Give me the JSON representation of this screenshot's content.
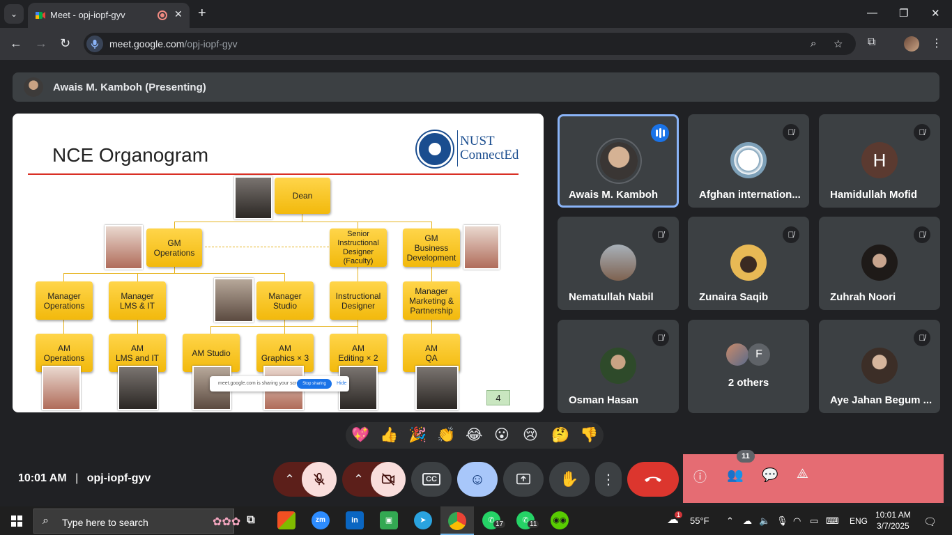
{
  "browser": {
    "tab_title": "Meet - opj-iopf-gyv",
    "url_host": "meet.google.com",
    "url_path": "/opj-iopf-gyv"
  },
  "meet": {
    "presenter_label": "Awais M. Kamboh (Presenting)",
    "meeting_code": "opj-iopf-gyv",
    "time": "10:01 AM",
    "time_separator": "|",
    "participants_count": "11"
  },
  "slide": {
    "title": "NCE Organogram",
    "logo_line1": "NUST",
    "logo_line2": "ConnectEd",
    "boxes": {
      "dean": "Dean",
      "gm_ops_1": "GM",
      "gm_ops_2": "Operations",
      "sid_1": "Senior",
      "sid_2": "Instructional",
      "sid_3": "Designer",
      "sid_4": "(Faculty)",
      "gm_bd_1": "GM",
      "gm_bd_2": "Business",
      "gm_bd_3": "Development",
      "mgr_ops_1": "Manager",
      "mgr_ops_2": "Operations",
      "mgr_lms_1": "Manager",
      "mgr_lms_2": "LMS & IT",
      "mgr_studio_1": "Manager",
      "mgr_studio_2": "Studio",
      "id_1": "Instructional",
      "id_2": "Designer",
      "mgr_mkt_1": "Manager",
      "mgr_mkt_2": "Marketing &",
      "mgr_mkt_3": "Partnership",
      "am_ops_1": "AM",
      "am_ops_2": "Operations",
      "am_lms_1": "AM",
      "am_lms_2": "LMS and IT",
      "am_studio": "AM Studio",
      "am_gfx_1": "AM",
      "am_gfx_2": "Graphics × 3",
      "am_edit_1": "AM",
      "am_edit_2": "Editing × 2",
      "am_qa_1": "AM",
      "am_qa_2": "QA"
    },
    "page_number": "4",
    "share_notice": "meet.google.com is sharing your screen.",
    "stop_sharing": "Stop sharing",
    "hide": "Hide"
  },
  "participants": [
    {
      "name": "Awais M. Kamboh"
    },
    {
      "name": "Afghan internation..."
    },
    {
      "name": "Hamidullah Mofid",
      "initial": "H"
    },
    {
      "name": "Nematullah Nabil"
    },
    {
      "name": "Zunaira Saqib"
    },
    {
      "name": "Zuhrah Noori"
    },
    {
      "name": "Osman Hasan"
    },
    {
      "name": "2 others",
      "initial": "F"
    },
    {
      "name": "Aye Jahan Begum ..."
    }
  ],
  "reactions": [
    "💖",
    "👍",
    "🎉",
    "👏",
    "😂",
    "😮",
    "😢",
    "🤔",
    "👎"
  ],
  "taskbar": {
    "search_placeholder": "Type here to search",
    "weather": "55°F",
    "lang": "ENG",
    "time": "10:01 AM",
    "date": "3/7/2025",
    "weather_badge": "1",
    "whatsapp1_badge": "17",
    "whatsapp2_badge": "11"
  },
  "colors": {
    "accent_blue": "#8ab4f8",
    "end_call": "#dc362e",
    "org_box": "#f2b90c",
    "slide_line": "#d93025"
  }
}
